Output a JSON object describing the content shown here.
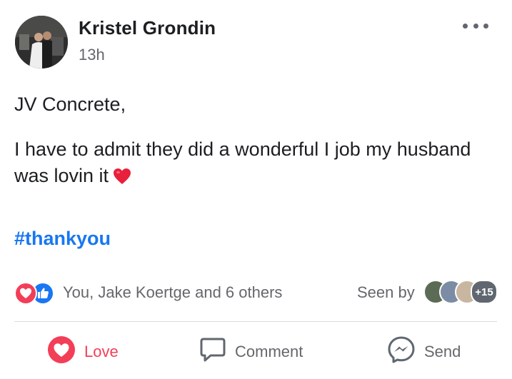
{
  "post": {
    "author": "Kristel Grondin",
    "time": "13h",
    "text_line1": "JV Concrete,",
    "text_line2": "I have to admit they did a wonderful I job my husband was lovin it",
    "hashtag": "#thankyou"
  },
  "reactions": {
    "summary": "You, Jake Koertge and 6 others",
    "seen_label": "Seen by",
    "seen_more": "+15",
    "types": [
      "love-icon",
      "like-icon"
    ]
  },
  "actions": {
    "love_label": "Love",
    "comment_label": "Comment",
    "send_label": "Send"
  },
  "colors": {
    "love": "#f33e58",
    "like": "#1877f2",
    "hashtag": "#1877f2",
    "secondary_text": "#65676b"
  }
}
